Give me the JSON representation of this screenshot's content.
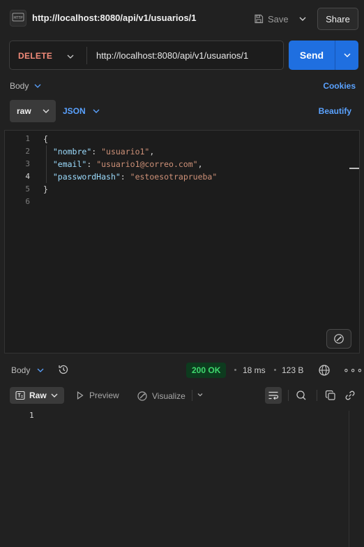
{
  "header": {
    "badge_text": "HTTP",
    "title": "http://localhost:8080/api/v1/usuarios/1",
    "save_label": "Save",
    "share_label": "Share"
  },
  "request": {
    "method": "DELETE",
    "url": "http://localhost:8080/api/v1/usuarios/1",
    "send_label": "Send"
  },
  "body_tabs": {
    "body_label": "Body",
    "cookies_label": "Cookies",
    "raw_label": "raw",
    "format_label": "JSON",
    "beautify_label": "Beautify"
  },
  "editor": {
    "line_numbers": [
      "1",
      "2",
      "3",
      "4",
      "5",
      "6"
    ],
    "lines": [
      {
        "open": "{"
      },
      {
        "key": "\"nombre\"",
        "value": "\"usuario1\"",
        "trail": ","
      },
      {
        "key": "\"email\"",
        "value": "\"usuario1@correo.com\"",
        "trail": ","
      },
      {
        "key": "\"passwordHash\"",
        "value": "\"estoesotraprueba\"",
        "trail": ""
      },
      {
        "open": "}"
      },
      {
        "open": ""
      }
    ]
  },
  "response": {
    "body_label": "Body",
    "status": "200 OK",
    "time": "18 ms",
    "size": "123 B",
    "more": "∘∘∘",
    "raw_label": "Raw",
    "preview_label": "Preview",
    "visualize_label": "Visualize",
    "line_number": "1"
  },
  "colors": {
    "send": "#1f6fe0",
    "method": "#f38b7a",
    "link": "#5aa2ff",
    "status_ok": "#3fd96e"
  }
}
